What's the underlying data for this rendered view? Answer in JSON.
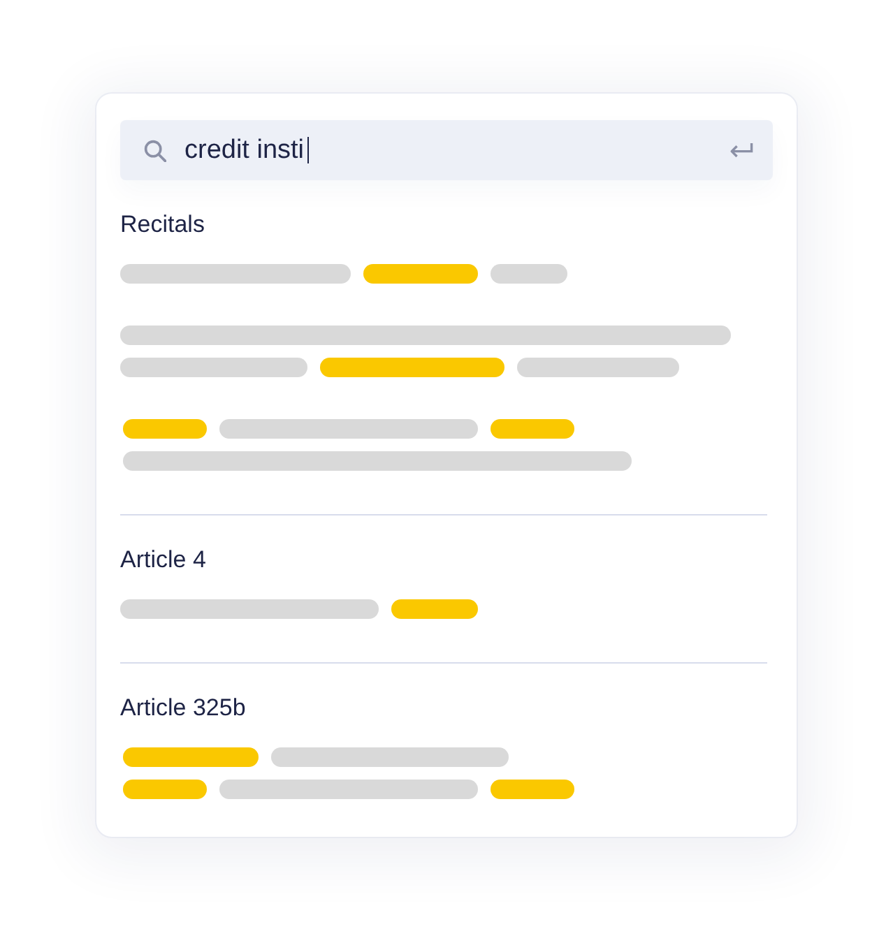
{
  "search": {
    "value": "credit insti",
    "focused": true
  },
  "results": [
    {
      "heading": "Recitals",
      "snippets": [
        {
          "lines": [
            {
              "segments": [
                {
                  "kind": "plain"
                },
                {
                  "kind": "match"
                },
                {
                  "kind": "plain"
                }
              ]
            }
          ]
        },
        {
          "lines": [
            {
              "segments": [
                {
                  "kind": "plain"
                }
              ]
            },
            {
              "segments": [
                {
                  "kind": "plain"
                },
                {
                  "kind": "match"
                },
                {
                  "kind": "plain"
                }
              ]
            }
          ]
        },
        {
          "lines": [
            {
              "segments": [
                {
                  "kind": "match"
                },
                {
                  "kind": "plain"
                },
                {
                  "kind": "match"
                }
              ]
            },
            {
              "segments": [
                {
                  "kind": "plain"
                }
              ]
            }
          ]
        }
      ]
    },
    {
      "heading": "Article 4",
      "snippets": [
        {
          "lines": [
            {
              "segments": [
                {
                  "kind": "plain"
                },
                {
                  "kind": "match"
                }
              ]
            }
          ]
        }
      ]
    },
    {
      "heading": "Article 325b",
      "snippets": [
        {
          "lines": [
            {
              "segments": [
                {
                  "kind": "match"
                },
                {
                  "kind": "plain"
                }
              ]
            },
            {
              "segments": [
                {
                  "kind": "match"
                },
                {
                  "kind": "plain"
                },
                {
                  "kind": "match"
                }
              ]
            }
          ]
        }
      ]
    }
  ]
}
